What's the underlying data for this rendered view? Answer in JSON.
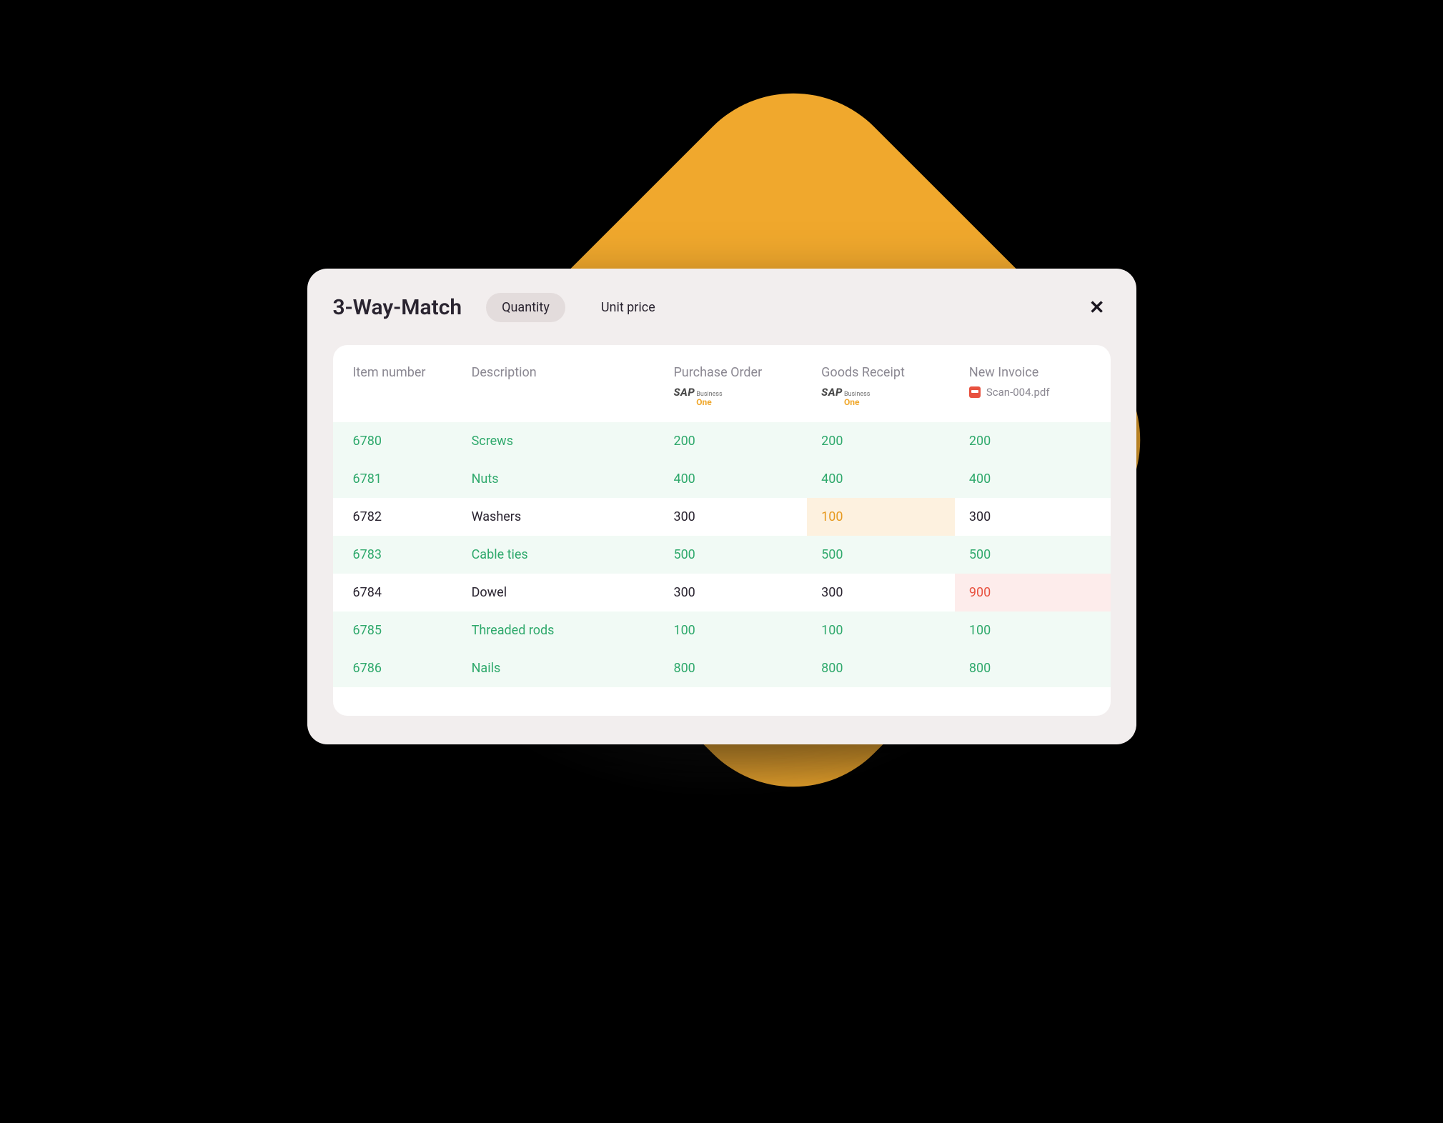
{
  "title": "3-Way-Match",
  "tabs": {
    "quantity": "Quantity",
    "unit_price": "Unit price"
  },
  "columns": {
    "item_number": "Item number",
    "description": "Description",
    "po": "Purchase Order",
    "gr": "Goods Receipt",
    "inv": "New Invoice",
    "inv_file": "Scan-004.pdf",
    "sap_label_a": "SAP",
    "sap_label_b": "Business",
    "sap_label_c": "One"
  },
  "rows": [
    {
      "item": "6780",
      "desc": "Screws",
      "po": "200",
      "gr": "200",
      "inv": "200",
      "status": "match"
    },
    {
      "item": "6781",
      "desc": "Nuts",
      "po": "400",
      "gr": "400",
      "inv": "400",
      "status": "match"
    },
    {
      "item": "6782",
      "desc": "Washers",
      "po": "300",
      "gr": "100",
      "inv": "300",
      "status": "mismatch",
      "gr_flag": "warn"
    },
    {
      "item": "6783",
      "desc": "Cable ties",
      "po": "500",
      "gr": "500",
      "inv": "500",
      "status": "match"
    },
    {
      "item": "6784",
      "desc": "Dowel",
      "po": "300",
      "gr": "300",
      "inv": "900",
      "status": "mismatch",
      "inv_flag": "error"
    },
    {
      "item": "6785",
      "desc": "Threaded rods",
      "po": "100",
      "gr": "100",
      "inv": "100",
      "status": "match"
    },
    {
      "item": "6786",
      "desc": "Nails",
      "po": "800",
      "gr": "800",
      "inv": "800",
      "status": "match"
    }
  ]
}
